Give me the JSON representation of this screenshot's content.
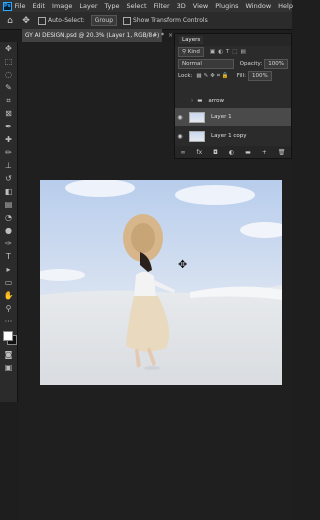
{
  "app": {
    "logo": "Ps"
  },
  "menu": [
    "File",
    "Edit",
    "Image",
    "Layer",
    "Type",
    "Select",
    "Filter",
    "3D",
    "View",
    "Plugins",
    "Window",
    "Help"
  ],
  "options": {
    "auto_select_label": "Auto-Select:",
    "group_value": "Group",
    "show_transform_label": "Show Transform Controls"
  },
  "document": {
    "tab_title": "GY AI DESIGN.psd @ 20.3% (Layer 1, RGB/8#) *",
    "close_glyph": "×"
  },
  "layers_panel": {
    "tab_label": "Layers",
    "filter_kind": "Kind",
    "blend_mode": "Normal",
    "opacity_label": "Opacity:",
    "opacity_value": "100%",
    "lock_label": "Lock:",
    "fill_label": "Fill:",
    "fill_value": "100%",
    "layers": [
      {
        "name": "arrow",
        "type": "group",
        "visible": false
      },
      {
        "name": "Layer 1",
        "type": "layer",
        "visible": true,
        "selected": true
      },
      {
        "name": "Layer 1 copy",
        "type": "layer",
        "visible": true,
        "selected": false
      }
    ]
  },
  "colors": {
    "accent": "#31a8ff",
    "panel_bg": "#2b2b2b",
    "canvas_bg": "#1f1f1f",
    "selected_layer": "#4a4a4a"
  }
}
